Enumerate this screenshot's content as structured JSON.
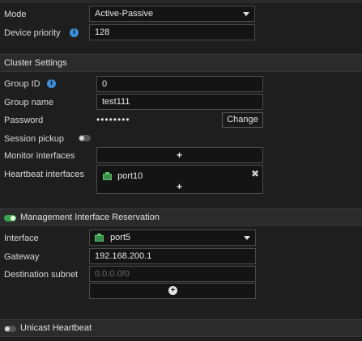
{
  "top": {
    "mode_label": "Mode",
    "mode_value": "Active-Passive",
    "device_priority_label": "Device priority",
    "device_priority_value": "128"
  },
  "cluster": {
    "section_title": "Cluster Settings",
    "group_id_label": "Group ID",
    "group_id_value": "0",
    "group_name_label": "Group name",
    "group_name_value": "test111",
    "password_label": "Password",
    "password_mask": "••••••••",
    "change_button": "Change",
    "session_pickup_label": "Session pickup",
    "session_pickup_enabled": false,
    "monitor_interfaces_label": "Monitor interfaces",
    "heartbeat_interfaces_label": "Heartbeat interfaces",
    "heartbeat_interfaces": [
      "port10"
    ]
  },
  "mgmt": {
    "section_title": "Management Interface Reservation",
    "enabled": true,
    "interface_label": "Interface",
    "interface_value": "port5",
    "gateway_label": "Gateway",
    "gateway_value": "192.168.200.1",
    "dest_subnet_label": "Destination subnet",
    "dest_subnet_placeholder": "0.0.0.0/0"
  },
  "unicast": {
    "section_title": "Unicast Heartbeat",
    "enabled": false
  },
  "icons": {
    "info": "info-icon",
    "dropdown": "chevron-down-icon",
    "add": "plus-icon",
    "remove": "close-icon",
    "port": "network-port-icon"
  },
  "colors": {
    "background": "#1e1e1e",
    "section_bg": "#2b2b2b",
    "info_blue": "#3d8fd8",
    "toggle_on": "#3aa64a",
    "port_green": "#3a8d4a"
  }
}
